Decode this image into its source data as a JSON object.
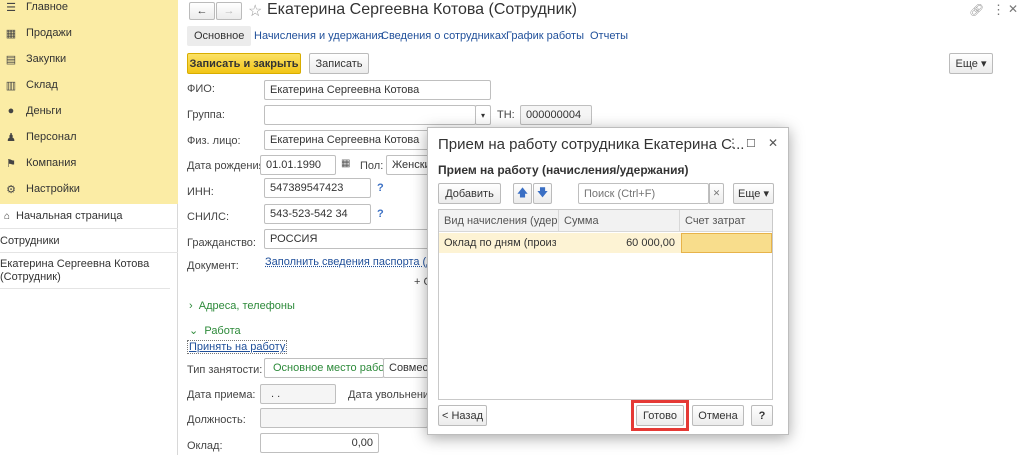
{
  "sidebar": {
    "menu": [
      {
        "label": "Главное",
        "icon": "menu-lines-icon"
      },
      {
        "label": "Продажи",
        "icon": "shop-icon"
      },
      {
        "label": "Закупки",
        "icon": "cart-icon"
      },
      {
        "label": "Склад",
        "icon": "warehouse-icon"
      },
      {
        "label": "Деньги",
        "icon": "coin-icon"
      },
      {
        "label": "Персонал",
        "icon": "person-icon"
      },
      {
        "label": "Компания",
        "icon": "flag-icon"
      },
      {
        "label": "Настройки",
        "icon": "gear-icon"
      }
    ],
    "home": "Начальная страница",
    "employees": "Сотрудники",
    "current": "Екатерина Сергеевна Котова (Сотрудник)"
  },
  "window": {
    "title": "Екатерина Сергеевна Котова (Сотрудник)",
    "back": "←",
    "forward": "→",
    "star": "☆",
    "link_icon": "⌘",
    "more_icon": "⋮",
    "close_icon": "✕"
  },
  "tabs": [
    "Основное",
    "Начисления и удержания",
    "Сведения о сотрудниках",
    "График работы",
    "Отчеты"
  ],
  "toolbar": {
    "save_close": "Записать и закрыть",
    "save": "Записать",
    "more": "Еще ▾"
  },
  "form": {
    "fio_label": "ФИО:",
    "fio_value": "Екатерина Сергеевна Котова",
    "group_label": "Группа:",
    "group_value": "",
    "tn_label": "ТН:",
    "tn_value": "000000004",
    "person_label": "Физ. лицо:",
    "person_value": "Екатерина Сергеевна Котова",
    "birth_label": "Дата рождения:",
    "birth_value": "01.01.1990",
    "sex_label": "Пол:",
    "sex_value": "Женский",
    "inn_label": "ИНН:",
    "inn_value": "547389547423",
    "snils_label": "СНИЛС:",
    "snils_value": "543-523-542 34",
    "citizenship_label": "Гражданство:",
    "citizenship_value": "РОССИЯ",
    "document_label": "Документ:",
    "document_link": "Заполнить сведения паспорта (друг",
    "add_text": "+ С",
    "help_mark": "?",
    "address_group": "Адреса, телефоны",
    "work_group": "Работа",
    "hire_link": "Принять на работу",
    "employment_label": "Тип занятости:",
    "employment_main": "Основное место работы",
    "employment_other": "Совмес",
    "hire_date_label": "Дата приема:",
    "hire_date_value": ". .",
    "dismiss_label": "Дата увольнения:",
    "position_label": "Должность:",
    "salary_label": "Оклад:",
    "salary_value": "0,00"
  },
  "dialog": {
    "title": "Прием на работу сотрудника Екатерина С...",
    "subtitle": "Прием на работу (начисления/удержания)",
    "add_button": "Добавить",
    "search_placeholder": "Поиск (Ctrl+F)",
    "more_button": "Еще ▾",
    "columns": [
      "Вид начисления (удер...",
      "Сумма",
      "Счет затрат"
    ],
    "rows": [
      [
        "Оклад по дням (произ...",
        "60 000,00",
        ""
      ]
    ],
    "back_button": "< Назад",
    "done_button": "Готово",
    "cancel_button": "Отмена",
    "help_button": "?",
    "highlight_color": "#e53935"
  }
}
